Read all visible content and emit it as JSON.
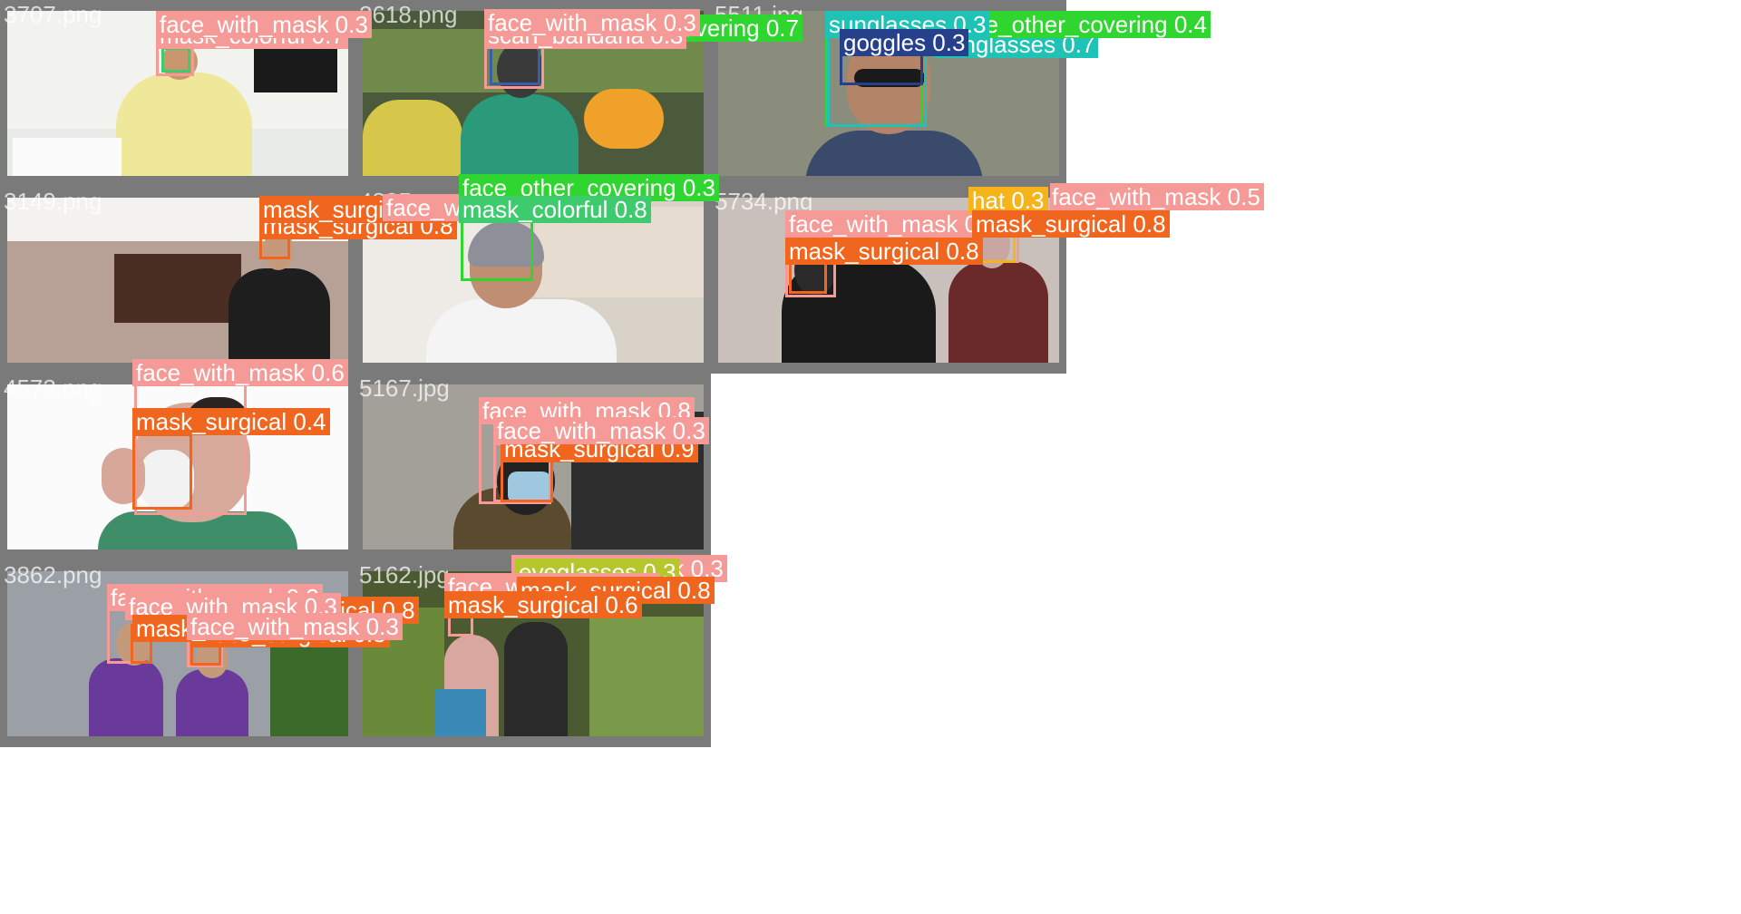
{
  "colors": {
    "tile_border": "#7a7a7a",
    "face_with_mask": "#f59a96",
    "mask_surgical": "#f0661f",
    "mask_colorful": "#3ecb6e",
    "face_other_covering": "#2fd62f",
    "sunglasses": "#1ec3b5",
    "goggles": "#27408b",
    "eyeglasses": "#b7c62d",
    "hat": "#f5b41a",
    "scarf_bandana": "#f59a96"
  },
  "tiles": [
    {
      "filename": "3707.png",
      "detections": [
        {
          "label": "face_with_mask 0.3",
          "cls": "face_with_mask"
        },
        {
          "label": "mask_colorful 0.7",
          "cls": "mask_colorful"
        }
      ]
    },
    {
      "filename": "2618.png",
      "detections": [
        {
          "label": "face_with_mask 0.3",
          "cls": "face_with_mask"
        },
        {
          "label": "scarf_bandana 0.3",
          "cls": "scarf_bandana"
        },
        {
          "label": "face_other_covering 0.7",
          "cls": "face_other_covering"
        }
      ]
    },
    {
      "filename": "5511.jpg",
      "detections": [
        {
          "label": "sunglasses 0.3",
          "cls": "sunglasses"
        },
        {
          "label": "face_other_covering 0.4",
          "cls": "face_other_covering"
        },
        {
          "label": "goggles 0.3",
          "cls": "goggles"
        },
        {
          "label": "sunglasses 0.7",
          "cls": "sunglasses"
        }
      ]
    },
    {
      "filename": "3149.png",
      "detections": [
        {
          "label": "mask_surgical 0.4",
          "cls": "mask_surgical"
        },
        {
          "label": "mask_surgical 0.8",
          "cls": "mask_surgical"
        }
      ]
    },
    {
      "filename": "4835.png",
      "detections": [
        {
          "label": "face_with_mask 0.8",
          "cls": "face_with_mask"
        },
        {
          "label": "face_other_covering 0.3",
          "cls": "face_other_covering"
        },
        {
          "label": "mask_colorful 0.8",
          "cls": "mask_colorful"
        }
      ]
    },
    {
      "filename": "5734.png",
      "detections": [
        {
          "label": "face_with_mask 0.5",
          "cls": "face_with_mask"
        },
        {
          "label": "mask_surgical 0.8",
          "cls": "mask_surgical"
        },
        {
          "label": "hat 0.3",
          "cls": "hat"
        },
        {
          "label": "face_with_mask 0.5",
          "cls": "face_with_mask"
        },
        {
          "label": "mask_surgical 0.8",
          "cls": "mask_surgical"
        }
      ]
    },
    {
      "filename": "4573.png",
      "detections": [
        {
          "label": "face_with_mask 0.6",
          "cls": "face_with_mask"
        },
        {
          "label": "mask_surgical 0.4",
          "cls": "mask_surgical"
        }
      ]
    },
    {
      "filename": "5167.jpg",
      "detections": [
        {
          "label": "face_with_mask 0.8",
          "cls": "face_with_mask"
        },
        {
          "label": "face_with_mask 0.3",
          "cls": "face_with_mask"
        },
        {
          "label": "mask_surgical 0.9",
          "cls": "mask_surgical"
        }
      ]
    },
    {
      "filename": "3862.png",
      "detections": [
        {
          "label": "face_with_mask 0.3",
          "cls": "face_with_mask"
        },
        {
          "label": "face_with_mask 0.3",
          "cls": "face_with_mask"
        },
        {
          "label": "mask_surgical 0.8",
          "cls": "mask_surgical"
        },
        {
          "label": "mask_surgical 0.8",
          "cls": "mask_surgical"
        },
        {
          "label": "face_with_mask 0.3",
          "cls": "face_with_mask"
        },
        {
          "label": "mask_surgical 0.8",
          "cls": "mask_surgical"
        }
      ]
    },
    {
      "filename": "5162.jpg",
      "detections": [
        {
          "label": "face_with_mask 0.3",
          "cls": "face_with_mask"
        },
        {
          "label": "eyeglasses 0.3",
          "cls": "eyeglasses"
        },
        {
          "label": "face_with_mask 0.8",
          "cls": "face_with_mask"
        },
        {
          "label": "mask_surgical 0.8",
          "cls": "mask_surgical"
        },
        {
          "label": "mask_surgical 0.6",
          "cls": "mask_surgical"
        }
      ]
    }
  ]
}
